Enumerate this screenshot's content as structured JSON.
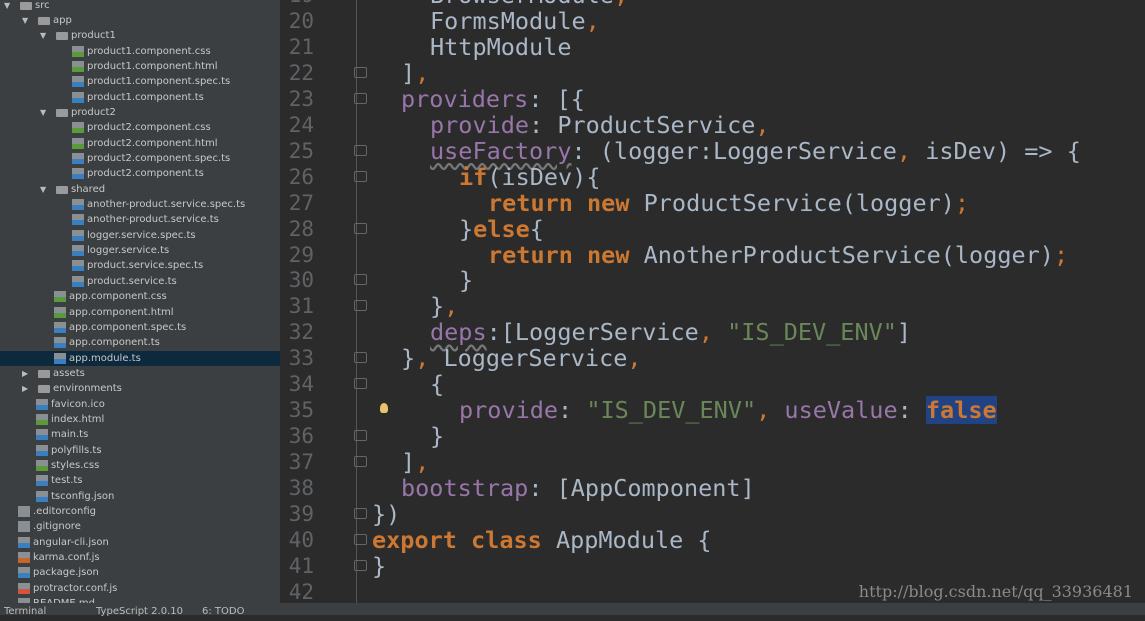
{
  "sidebar": {
    "items": [
      {
        "label": "src",
        "depth": 0,
        "type": "folder",
        "open": true
      },
      {
        "label": "app",
        "depth": 1,
        "type": "folder",
        "open": true
      },
      {
        "label": "product1",
        "depth": 2,
        "type": "folder",
        "open": true
      },
      {
        "label": "product1.component.css",
        "depth": 3,
        "type": "css"
      },
      {
        "label": "product1.component.html",
        "depth": 3,
        "type": "html"
      },
      {
        "label": "product1.component.spec.ts",
        "depth": 3,
        "type": "ts"
      },
      {
        "label": "product1.component.ts",
        "depth": 3,
        "type": "ts"
      },
      {
        "label": "product2",
        "depth": 2,
        "type": "folder",
        "open": true
      },
      {
        "label": "product2.component.css",
        "depth": 3,
        "type": "css"
      },
      {
        "label": "product2.component.html",
        "depth": 3,
        "type": "html"
      },
      {
        "label": "product2.component.spec.ts",
        "depth": 3,
        "type": "ts"
      },
      {
        "label": "product2.component.ts",
        "depth": 3,
        "type": "ts"
      },
      {
        "label": "shared",
        "depth": 2,
        "type": "folder",
        "open": true
      },
      {
        "label": "another-product.service.spec.ts",
        "depth": 3,
        "type": "ts"
      },
      {
        "label": "another-product.service.ts",
        "depth": 3,
        "type": "ts"
      },
      {
        "label": "logger.service.spec.ts",
        "depth": 3,
        "type": "ts"
      },
      {
        "label": "logger.service.ts",
        "depth": 3,
        "type": "ts"
      },
      {
        "label": "product.service.spec.ts",
        "depth": 3,
        "type": "ts"
      },
      {
        "label": "product.service.ts",
        "depth": 3,
        "type": "ts"
      },
      {
        "label": "app.component.css",
        "depth": 2,
        "type": "css"
      },
      {
        "label": "app.component.html",
        "depth": 2,
        "type": "html"
      },
      {
        "label": "app.component.spec.ts",
        "depth": 2,
        "type": "ts"
      },
      {
        "label": "app.component.ts",
        "depth": 2,
        "type": "ts"
      },
      {
        "label": "app.module.ts",
        "depth": 2,
        "type": "ts",
        "selected": true
      },
      {
        "label": "assets",
        "depth": 1,
        "type": "folder",
        "open": false
      },
      {
        "label": "environments",
        "depth": 1,
        "type": "folder",
        "open": false
      },
      {
        "label": "favicon.ico",
        "depth": 1,
        "type": "ico"
      },
      {
        "label": "index.html",
        "depth": 1,
        "type": "html"
      },
      {
        "label": "main.ts",
        "depth": 1,
        "type": "ts"
      },
      {
        "label": "polyfills.ts",
        "depth": 1,
        "type": "ts"
      },
      {
        "label": "styles.css",
        "depth": 1,
        "type": "css"
      },
      {
        "label": "test.ts",
        "depth": 1,
        "type": "ts"
      },
      {
        "label": "tsconfig.json",
        "depth": 1,
        "type": "json"
      },
      {
        "label": ".editorconfig",
        "depth": 0,
        "type": "plain"
      },
      {
        "label": ".gitignore",
        "depth": 0,
        "type": "plain"
      },
      {
        "label": "angular-cli.json",
        "depth": 0,
        "type": "json"
      },
      {
        "label": "karma.conf.js",
        "depth": 0,
        "type": "js"
      },
      {
        "label": "package.json",
        "depth": 0,
        "type": "json"
      },
      {
        "label": "protractor.conf.js",
        "depth": 0,
        "type": "protractor"
      },
      {
        "label": "README.md",
        "depth": 0,
        "type": "plain"
      }
    ]
  },
  "icon_colors": {
    "css": "#5a9a3a",
    "html": "#5a9a3a",
    "ts": "#3a7fc0",
    "json": "#3a7fc0",
    "js": "#c8662a",
    "ico": "#3a7fc0",
    "plain": "#8a8f94",
    "protractor": "#d0553c"
  },
  "editor": {
    "first_line": 19,
    "lines": [
      {
        "indent": 2,
        "tokens": [
          [
            "BrowserModule",
            ""
          ],
          [
            ",",
            "o"
          ]
        ]
      },
      {
        "indent": 2,
        "tokens": [
          [
            "FormsModule",
            ""
          ],
          [
            ",",
            "o"
          ]
        ]
      },
      {
        "indent": 2,
        "tokens": [
          [
            "HttpModule",
            ""
          ]
        ]
      },
      {
        "indent": 1,
        "fold": true,
        "tokens": [
          [
            "]",
            ""
          ],
          [
            ",",
            "o"
          ]
        ]
      },
      {
        "indent": 1,
        "fold": true,
        "tokens": [
          [
            "providers",
            "p"
          ],
          [
            ": [{",
            ""
          ]
        ]
      },
      {
        "indent": 2,
        "tokens": [
          [
            "provide",
            "p"
          ],
          [
            ": ProductService",
            ""
          ],
          [
            ",",
            "o"
          ]
        ]
      },
      {
        "indent": 2,
        "fold": true,
        "tokens": [
          [
            "useFactory",
            "p w"
          ],
          [
            ": (logger:LoggerService",
            ""
          ],
          [
            ",",
            "o"
          ],
          [
            " isDev) => {",
            ""
          ]
        ]
      },
      {
        "indent": 3,
        "fold": true,
        "tokens": [
          [
            "if",
            "k"
          ],
          [
            "(isDev){",
            ""
          ]
        ]
      },
      {
        "indent": 4,
        "tokens": [
          [
            "return new ",
            "k"
          ],
          [
            "ProductService(logger)",
            ""
          ],
          [
            ";",
            "o"
          ]
        ]
      },
      {
        "indent": 3,
        "fold": true,
        "tokens": [
          [
            "}",
            ""
          ],
          [
            "else",
            "k"
          ],
          [
            "{",
            ""
          ]
        ]
      },
      {
        "indent": 4,
        "tokens": [
          [
            "return new ",
            "k"
          ],
          [
            "AnotherProductService(logger)",
            ""
          ],
          [
            ";",
            "o"
          ]
        ]
      },
      {
        "indent": 3,
        "fold": true,
        "tokens": [
          [
            "}",
            ""
          ]
        ]
      },
      {
        "indent": 2,
        "fold": true,
        "tokens": [
          [
            "}",
            ""
          ],
          [
            ",",
            "o"
          ]
        ]
      },
      {
        "indent": 2,
        "tokens": [
          [
            "deps",
            "p w"
          ],
          [
            ":[LoggerService",
            ""
          ],
          [
            ", ",
            "o"
          ],
          [
            "\"IS_DEV_ENV\"",
            "s"
          ],
          [
            "]",
            ""
          ]
        ]
      },
      {
        "indent": 1,
        "fold": true,
        "tokens": [
          [
            "}",
            ""
          ],
          [
            ", ",
            "o"
          ],
          [
            "LoggerService",
            ""
          ],
          [
            ",",
            "o"
          ]
        ]
      },
      {
        "indent": 2,
        "fold": true,
        "tokens": [
          [
            "{",
            ""
          ]
        ]
      },
      {
        "indent": 3,
        "bulb": true,
        "tokens": [
          [
            "provide",
            "p"
          ],
          [
            ": ",
            ""
          ],
          [
            "\"IS_DEV_ENV\"",
            "s"
          ],
          [
            ", ",
            "o"
          ],
          [
            "useValue",
            "p"
          ],
          [
            ": ",
            ""
          ],
          [
            "false",
            "k hl"
          ]
        ]
      },
      {
        "indent": 2,
        "fold": true,
        "tokens": [
          [
            "}",
            ""
          ]
        ]
      },
      {
        "indent": 1,
        "fold": true,
        "tokens": [
          [
            "]",
            ""
          ],
          [
            ",",
            "o"
          ]
        ]
      },
      {
        "indent": 1,
        "tokens": [
          [
            "bootstrap",
            "p"
          ],
          [
            ": [AppComponent]",
            ""
          ]
        ]
      },
      {
        "indent": 0,
        "fold": true,
        "tokens": [
          [
            "})",
            ""
          ]
        ]
      },
      {
        "indent": 0,
        "fold": true,
        "tokens": [
          [
            "export class ",
            "k"
          ],
          [
            "AppModule {",
            ""
          ]
        ]
      },
      {
        "indent": 0,
        "fold": true,
        "tokens": [
          [
            "}",
            ""
          ]
        ]
      },
      {
        "indent": 0,
        "tokens": []
      }
    ]
  },
  "watermark": "http://blog.csdn.net/qq_33936481",
  "statusbar": {
    "terminal": "Terminal",
    "typescript": "TypeScript 2.0.10",
    "todo": "6: TODO"
  }
}
